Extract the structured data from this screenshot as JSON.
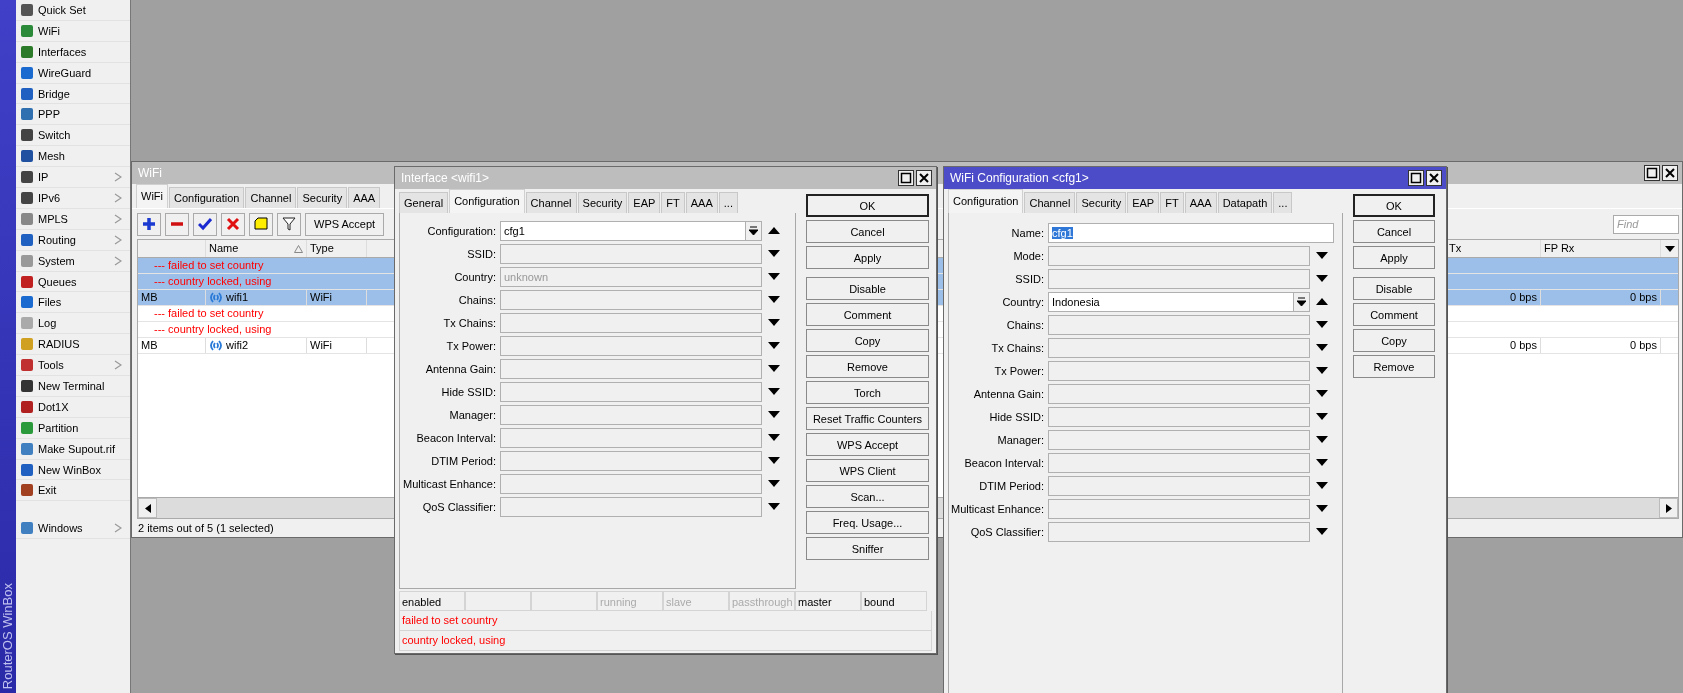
{
  "sidebar": {
    "brand": "RouterOS WinBox",
    "items": [
      {
        "label": "Quick Set",
        "submenu": false
      },
      {
        "label": "WiFi",
        "submenu": false
      },
      {
        "label": "Interfaces",
        "submenu": false
      },
      {
        "label": "WireGuard",
        "submenu": false
      },
      {
        "label": "Bridge",
        "submenu": false
      },
      {
        "label": "PPP",
        "submenu": false
      },
      {
        "label": "Switch",
        "submenu": false
      },
      {
        "label": "Mesh",
        "submenu": false
      },
      {
        "label": "IP",
        "submenu": true
      },
      {
        "label": "IPv6",
        "submenu": true
      },
      {
        "label": "MPLS",
        "submenu": true
      },
      {
        "label": "Routing",
        "submenu": true
      },
      {
        "label": "System",
        "submenu": true
      },
      {
        "label": "Queues",
        "submenu": false
      },
      {
        "label": "Files",
        "submenu": false
      },
      {
        "label": "Log",
        "submenu": false
      },
      {
        "label": "RADIUS",
        "submenu": false
      },
      {
        "label": "Tools",
        "submenu": true
      },
      {
        "label": "New Terminal",
        "submenu": false
      },
      {
        "label": "Dot1X",
        "submenu": false
      },
      {
        "label": "Partition",
        "submenu": false
      },
      {
        "label": "Make Supout.rif",
        "submenu": false
      },
      {
        "label": "New WinBox",
        "submenu": false
      },
      {
        "label": "Exit",
        "submenu": false
      },
      {
        "label": "Windows",
        "submenu": true
      }
    ]
  },
  "wifi_window": {
    "title": "WiFi",
    "active": false,
    "tabs": [
      {
        "label": "WiFi",
        "selected": true
      },
      {
        "label": "Configuration",
        "selected": false
      },
      {
        "label": "Channel",
        "selected": false
      },
      {
        "label": "Security",
        "selected": false
      },
      {
        "label": "AAA",
        "selected": false
      }
    ],
    "toolbar": {
      "tools": [
        {
          "kind": "add"
        },
        {
          "kind": "remove"
        },
        {
          "kind": "enable"
        },
        {
          "kind": "disable"
        },
        {
          "kind": "comment"
        },
        {
          "kind": "filter"
        },
        {
          "kind": "text",
          "label": "WPS Accept"
        }
      ],
      "find": {
        "placeholder": "Find"
      }
    },
    "table": {
      "columns": [
        {
          "label": "Name",
          "sorted": true
        },
        {
          "label": "Type",
          "sorted": false
        },
        {
          "label": "Tx",
          "sorted": false
        },
        {
          "label": "FP Rx",
          "sorted": false
        }
      ],
      "rows": [
        {
          "kind": "comment",
          "text": "--- failed to set country",
          "selected": true
        },
        {
          "kind": "comment",
          "text": "--- country locked, using",
          "selected": true
        },
        {
          "kind": "item",
          "flags": "MB",
          "name": "wifi1",
          "type": "WiFi",
          "tx": "0 bps",
          "fp_rx": "0 bps",
          "selected": true
        },
        {
          "kind": "comment",
          "text": "--- failed to set country",
          "selected": false
        },
        {
          "kind": "comment",
          "text": "--- country locked, using",
          "selected": false
        },
        {
          "kind": "item",
          "flags": "MB",
          "name": "wifi2",
          "type": "WiFi",
          "tx": "0 bps",
          "fp_rx": "0 bps",
          "selected": false
        }
      ]
    },
    "status_bar": "2 items out of 5 (1 selected)"
  },
  "interface_dialog": {
    "title": "Interface <wifi1>",
    "active": false,
    "tabs": [
      {
        "label": "General",
        "selected": false
      },
      {
        "label": "Configuration",
        "selected": true
      },
      {
        "label": "Channel",
        "selected": false
      },
      {
        "label": "Security",
        "selected": false
      },
      {
        "label": "EAP",
        "selected": false
      },
      {
        "label": "FT",
        "selected": false
      },
      {
        "label": "AAA",
        "selected": false
      },
      {
        "label": "...",
        "selected": false
      }
    ],
    "fields": [
      {
        "label": "Configuration:",
        "kind": "combo",
        "value": "cfg1",
        "expanded": true
      },
      {
        "label": "SSID:",
        "kind": "dropdown",
        "expanded": false
      },
      {
        "label": "Country:",
        "kind": "dropdown",
        "value": "unknown",
        "dimmed": true,
        "expanded": false
      },
      {
        "label": "Chains:",
        "kind": "dropdown",
        "expanded": false
      },
      {
        "label": "Tx Chains:",
        "kind": "dropdown",
        "expanded": false
      },
      {
        "label": "Tx Power:",
        "kind": "dropdown",
        "expanded": false
      },
      {
        "label": "Antenna Gain:",
        "kind": "dropdown",
        "expanded": false
      },
      {
        "label": "Hide SSID:",
        "kind": "dropdown",
        "expanded": false
      },
      {
        "label": "Manager:",
        "kind": "dropdown",
        "expanded": false
      },
      {
        "label": "Beacon Interval:",
        "kind": "dropdown",
        "expanded": false
      },
      {
        "label": "DTIM Period:",
        "kind": "dropdown",
        "expanded": false
      },
      {
        "label": "Multicast Enhance:",
        "kind": "dropdown",
        "expanded": false
      },
      {
        "label": "QoS Classifier:",
        "kind": "dropdown",
        "expanded": false
      }
    ],
    "button_groups": [
      [
        {
          "label": "OK",
          "default": true
        },
        {
          "label": "Cancel",
          "default": false
        },
        {
          "label": "Apply",
          "default": false
        }
      ],
      [
        {
          "label": "Disable",
          "default": false
        },
        {
          "label": "Comment",
          "default": false
        },
        {
          "label": "Copy",
          "default": false
        },
        {
          "label": "Remove",
          "default": false
        },
        {
          "label": "Torch",
          "default": false
        },
        {
          "label": "Reset Traffic Counters",
          "default": false
        },
        {
          "label": "WPS Accept",
          "default": false
        },
        {
          "label": "WPS Client",
          "default": false
        },
        {
          "label": "Scan...",
          "default": false
        },
        {
          "label": "Freq. Usage...",
          "default": false
        },
        {
          "label": "Sniffer",
          "default": false
        }
      ]
    ],
    "status_flags": [
      {
        "kind": "flag",
        "label": "enabled",
        "dimmed": false
      },
      {
        "kind": "blank"
      },
      {
        "kind": "blank"
      },
      {
        "kind": "flag",
        "label": "running",
        "dimmed": true
      },
      {
        "kind": "flag",
        "label": "slave",
        "dimmed": true
      },
      {
        "kind": "flag",
        "label": "passthrough",
        "dimmed": true
      },
      {
        "kind": "flag",
        "label": "master",
        "dimmed": false
      },
      {
        "kind": "flag",
        "label": "bound",
        "dimmed": false
      }
    ],
    "messages": [
      "failed to set country",
      "country locked, using"
    ]
  },
  "config_dialog": {
    "title": "WiFi Configuration <cfg1>",
    "active": true,
    "tabs": [
      {
        "label": "Configuration",
        "selected": true
      },
      {
        "label": "Channel",
        "selected": false
      },
      {
        "label": "Security",
        "selected": false
      },
      {
        "label": "EAP",
        "selected": false
      },
      {
        "label": "FT",
        "selected": false
      },
      {
        "label": "AAA",
        "selected": false
      },
      {
        "label": "Datapath",
        "selected": false
      },
      {
        "label": "...",
        "selected": false
      }
    ],
    "fields": [
      {
        "label": "Name:",
        "kind": "text",
        "value": "cfg1",
        "text_selected": true
      },
      {
        "label": "Mode:",
        "kind": "dropdown",
        "expanded": false
      },
      {
        "label": "SSID:",
        "kind": "dropdown",
        "expanded": false
      },
      {
        "label": "Country:",
        "kind": "combo",
        "value": "Indonesia",
        "expanded": true
      },
      {
        "label": "Chains:",
        "kind": "dropdown",
        "expanded": false
      },
      {
        "label": "Tx Chains:",
        "kind": "dropdown",
        "expanded": false
      },
      {
        "label": "Tx Power:",
        "kind": "dropdown",
        "expanded": false
      },
      {
        "label": "Antenna Gain:",
        "kind": "dropdown",
        "expanded": false
      },
      {
        "label": "Hide SSID:",
        "kind": "dropdown",
        "expanded": false
      },
      {
        "label": "Manager:",
        "kind": "dropdown",
        "expanded": false
      },
      {
        "label": "Beacon Interval:",
        "kind": "dropdown",
        "expanded": false
      },
      {
        "label": "DTIM Period:",
        "kind": "dropdown",
        "expanded": false
      },
      {
        "label": "Multicast Enhance:",
        "kind": "dropdown",
        "expanded": false
      },
      {
        "label": "QoS Classifier:",
        "kind": "dropdown",
        "expanded": false
      }
    ],
    "button_groups": [
      [
        {
          "label": "OK",
          "default": true
        },
        {
          "label": "Cancel",
          "default": false
        },
        {
          "label": "Apply",
          "default": false
        }
      ],
      [
        {
          "label": "Disable",
          "default": false
        },
        {
          "label": "Comment",
          "default": false
        },
        {
          "label": "Copy",
          "default": false
        },
        {
          "label": "Remove",
          "default": false
        }
      ]
    ]
  }
}
